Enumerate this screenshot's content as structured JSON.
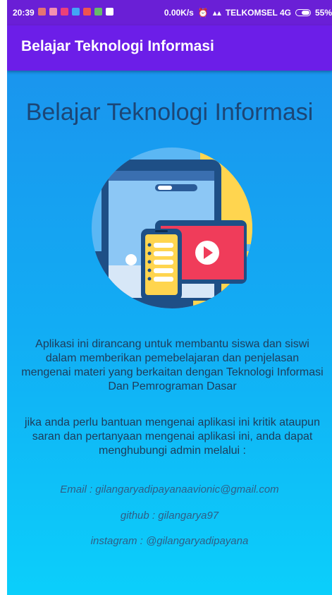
{
  "status_bar": {
    "time": "20:39",
    "network_speed": "0.00K/s",
    "carrier": "TELKOMSEL 4G",
    "battery": "55%",
    "notification_icons": [
      "#e57373",
      "#f48fb1",
      "#ec407a",
      "#42a5f5",
      "#ef5350",
      "#66bb6a",
      "#ffffff"
    ]
  },
  "app_bar": {
    "title": "Belajar Teknologi Informasi"
  },
  "main": {
    "heading": "Belajar Teknologi Informasi",
    "description": "Aplikasi ini dirancang untuk membantu siswa dan siswi dalam memberikan pemebelajaran dan penjelasan mengenai materi yang berkaitan dengan Teknologi Informasi Dan Pemrograman Dasar",
    "help_text": "jika anda perlu bantuan mengenai aplikasi ini kritik ataupun saran dan pertanyaan mengenai aplikasi ini, anda dapat menghubungi admin melalui :",
    "contact": {
      "email": "Email : gilangaryadipayanaavionic@gmail.com",
      "github": "github : gilangarya97",
      "instagram": "instagram : @gilangaryadipayana"
    }
  },
  "colors": {
    "status_bar": "#6a1fd6",
    "app_bar": "#6c1ee8",
    "gradient_top": "#1a95ee",
    "gradient_bottom": "#0bcffb",
    "heading": "#1c4676"
  }
}
